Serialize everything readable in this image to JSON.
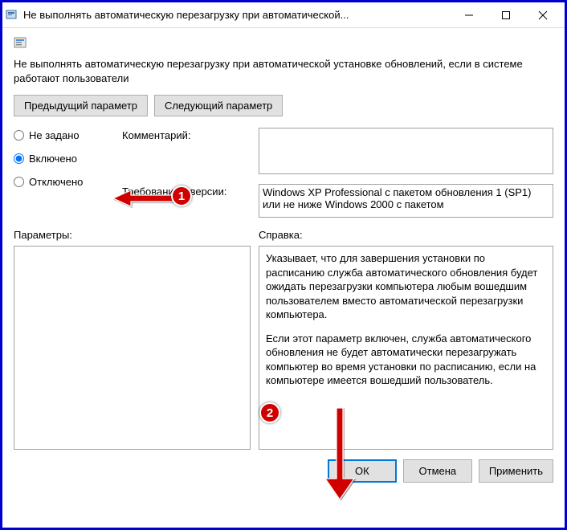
{
  "titlebar": {
    "title": "Не выполнять автоматическую перезагрузку при автоматической..."
  },
  "description": "Не выполнять автоматическую перезагрузку при автоматической установке обновлений, если в системе работают пользователи",
  "nav": {
    "prev": "Предыдущий параметр",
    "next": "Следующий параметр"
  },
  "radios": {
    "not_configured": "Не задано",
    "enabled": "Включено",
    "disabled": "Отключено"
  },
  "labels": {
    "comment": "Комментарий:",
    "requirements": "Требования к версии:",
    "params": "Параметры:",
    "help": "Справка:"
  },
  "fields": {
    "comment": "",
    "requirements": "Windows XP Professional с пакетом обновления 1 (SP1) или не ниже Windows 2000 с пакетом"
  },
  "help": {
    "p1": "Указывает, что для завершения установки по расписанию служба автоматического обновления будет ожидать перезагрузки компьютера любым вошедшим пользователем вместо автоматической перезагрузки компьютера.",
    "p2": "Если этот параметр включен, служба автоматического обновления не будет автоматически перезагружать компьютер во время установки по расписанию, если на компьютере имеется вошедший пользователь."
  },
  "footer": {
    "ok": "ОК",
    "cancel": "Отмена",
    "apply": "Применить"
  },
  "callouts": {
    "one": "1",
    "two": "2"
  }
}
